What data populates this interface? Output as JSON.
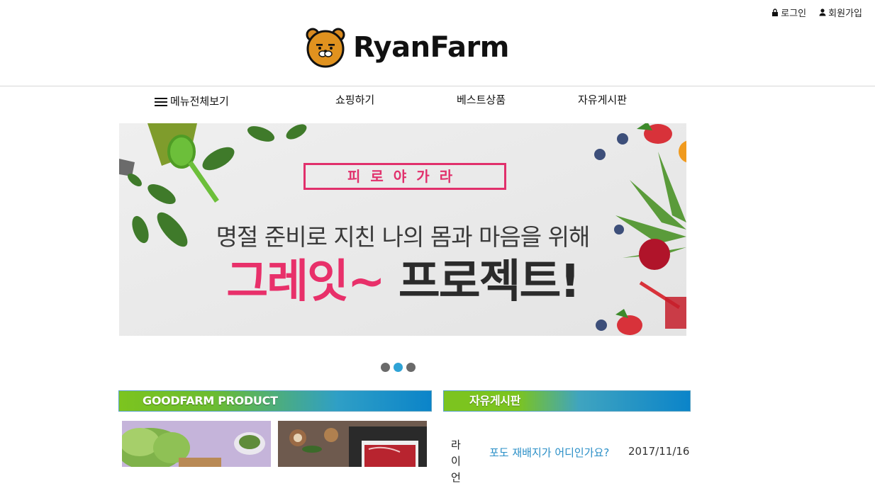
{
  "header": {
    "login_label": "로그인",
    "signup_label": "회원가입",
    "logo_text": "RyanFarm"
  },
  "nav": {
    "menu_all": "메뉴전체보기",
    "shopping": "쇼핑하기",
    "best": "베스트상품",
    "board": "자유게시판"
  },
  "banner": {
    "tag": "피로야가라",
    "subtitle": "명절 준비로 지친 나의 몸과 마음을 위해",
    "title_pink": "그레잇~",
    "title_dark": "프로젝트!"
  },
  "carousel": {
    "slide_count": 3,
    "active_index": 1
  },
  "sections": {
    "product_title": "GOODFARM PRODUCT",
    "board_title": "자유게시판"
  },
  "board": {
    "rows": [
      {
        "author": "라이언",
        "title": "포도 재배지가 어디인가요?",
        "date": "2017/11/16"
      }
    ]
  },
  "colors": {
    "accent_pink": "#e8306a",
    "link_blue": "#2a8fc7",
    "dot_active": "#2fa3d6",
    "header_green": "#7cc41f",
    "header_blue": "#0b84c9"
  }
}
